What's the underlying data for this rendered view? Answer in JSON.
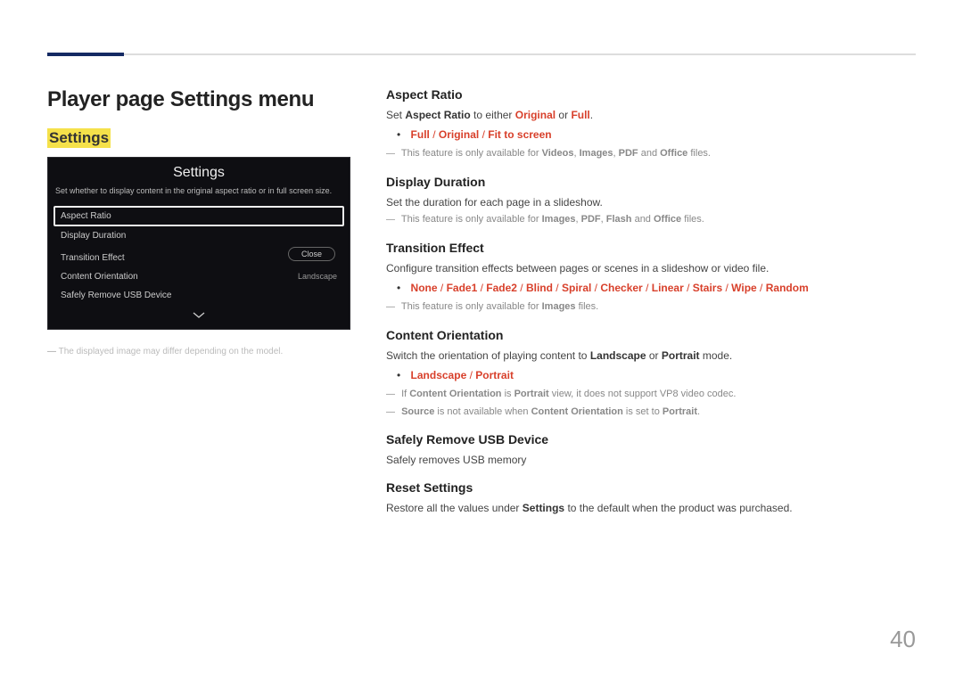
{
  "header": {
    "title": "Player page Settings menu"
  },
  "highlight": "Settings",
  "panel": {
    "title": "Settings",
    "desc": "Set whether to display content in the original aspect ratio or in full screen size.",
    "items": [
      {
        "label": "Aspect Ratio",
        "selected": true
      },
      {
        "label": "Display Duration"
      },
      {
        "label": "Transition Effect"
      },
      {
        "label": "Content Orientation",
        "value": "Landscape"
      },
      {
        "label": "Safely Remove USB Device"
      }
    ],
    "close": "Close"
  },
  "caption1": "―",
  "caption2": "The displayed image may differ depending on the model.",
  "sections": {
    "aspect": {
      "h": "Aspect Ratio",
      "p_pre": "Set ",
      "p_b1": "Aspect Ratio",
      "p_mid": " to either ",
      "p_r1": "Original",
      "p_or": " or ",
      "p_r2": "Full",
      "p_end": ".",
      "opts": [
        "Full",
        "Original",
        "Fit to screen"
      ],
      "note_pre": "This feature is only available for ",
      "note_b": [
        "Videos",
        "Images",
        "PDF",
        "Office"
      ],
      "note_suf": " files."
    },
    "duration": {
      "h": "Display Duration",
      "p": "Set the duration for each page in a slideshow.",
      "note_pre": "This feature is only available for ",
      "note_b": [
        "Images",
        "PDF",
        "Flash",
        "Office"
      ],
      "note_suf": " files."
    },
    "transition": {
      "h": "Transition Effect",
      "p": "Configure transition effects between pages or scenes in a slideshow or video file.",
      "opts": [
        "None",
        "Fade1",
        "Fade2",
        "Blind",
        "Spiral",
        "Checker",
        "Linear",
        "Stairs",
        "Wipe",
        "Random"
      ],
      "note_pre": "This feature is only available for ",
      "note_b": [
        "Images"
      ],
      "note_suf": " files."
    },
    "orient": {
      "h": "Content Orientation",
      "p_pre": "Switch the orientation of playing content to ",
      "p_b1": "Landscape",
      "p_or": " or ",
      "p_b2": "Portrait",
      "p_suf": " mode.",
      "opts": [
        "Landscape",
        "Portrait"
      ],
      "note1_pre": "If ",
      "note1_b1": "Content Orientation",
      "note1_mid": " is ",
      "note1_b2": "Portrait",
      "note1_suf": " view, it does not support VP8 video codec.",
      "note2_b1": "Source",
      "note2_mid": " is not available when ",
      "note2_b2": "Content Orientation",
      "note2_mid2": " is set to ",
      "note2_b3": "Portrait",
      "note2_end": "."
    },
    "usb": {
      "h": "Safely Remove USB Device",
      "p": "Safely removes USB memory"
    },
    "reset": {
      "h": "Reset Settings",
      "p_pre": "Restore all the values under ",
      "p_b": "Settings",
      "p_suf": " to the default when the product was purchased."
    }
  },
  "pagenum": "40"
}
